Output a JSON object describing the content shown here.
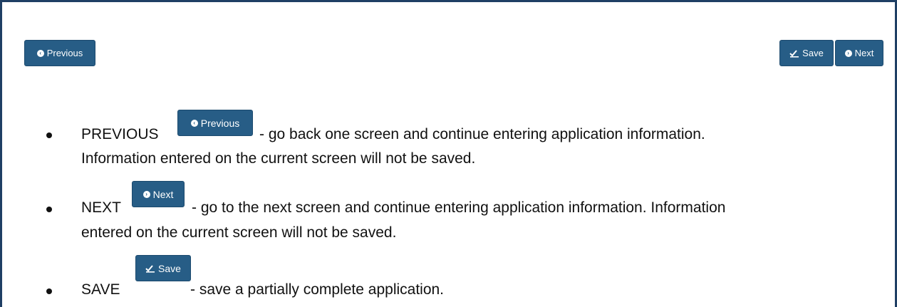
{
  "toolbar": {
    "previous_label": "Previous",
    "save_label": "Save",
    "next_label": "Next"
  },
  "items": [
    {
      "term": "PREVIOUS",
      "button_label": "Previous",
      "text_line1": "- go back one screen and continue entering application information.",
      "text_line2": "Information entered on the current screen will not be saved."
    },
    {
      "term": "NEXT",
      "button_label": "Next",
      "text_line1": "- go to the next screen and continue entering application information. Information",
      "text_line2": "entered on the current screen will not be saved."
    },
    {
      "term": "SAVE",
      "button_label": "Save",
      "text_line1": "- save a partially complete application."
    }
  ],
  "colors": {
    "button_bg": "#275d86",
    "frame_border": "#1f3f64"
  },
  "icons": {
    "previous": "chevron-left-circle-icon",
    "next": "chevron-right-circle-icon",
    "save": "save-check-icon"
  }
}
